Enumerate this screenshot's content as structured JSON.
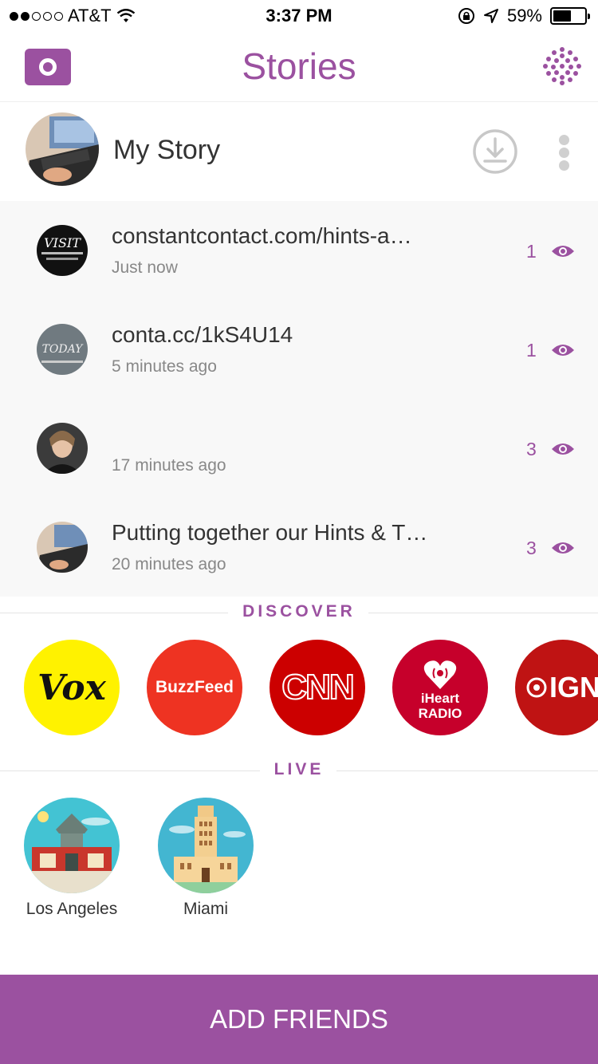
{
  "status_bar": {
    "carrier": "AT&T",
    "time": "3:37 PM",
    "battery": "59%",
    "battery_level": 0.59,
    "signal_bars": 2
  },
  "header": {
    "title": "Stories",
    "left_icon": "camera-icon",
    "right_icon": "dot-grid-icon"
  },
  "my_story": {
    "label": "My Story",
    "icons": [
      "download-icon",
      "more-icon"
    ]
  },
  "stories": [
    {
      "caption": "constantcontact.com/hints-a…",
      "time": "Just now",
      "views": "1"
    },
    {
      "caption": "conta.cc/1kS4U14",
      "time": "5 minutes ago",
      "views": "1"
    },
    {
      "caption": "",
      "time": "17 minutes ago",
      "views": "3"
    },
    {
      "caption": "Putting together our Hints & T…",
      "time": "20 minutes ago",
      "views": "3"
    }
  ],
  "discover": {
    "heading": "DISCOVER",
    "publishers": [
      {
        "name": "Vox",
        "color": "#fff200"
      },
      {
        "name": "BuzzFeed",
        "color": "#ee3322"
      },
      {
        "name": "CNN",
        "color": "#cc0000"
      },
      {
        "name": "iHeart RADIO",
        "color": "#c6002b"
      },
      {
        "name": "IGN",
        "color": "#bf1313"
      }
    ]
  },
  "live": {
    "heading": "LIVE",
    "items": [
      {
        "name": "Los Angeles"
      },
      {
        "name": "Miami"
      }
    ]
  },
  "footer": {
    "button": "ADD FRIENDS"
  },
  "colors": {
    "accent": "#9b51a0"
  }
}
